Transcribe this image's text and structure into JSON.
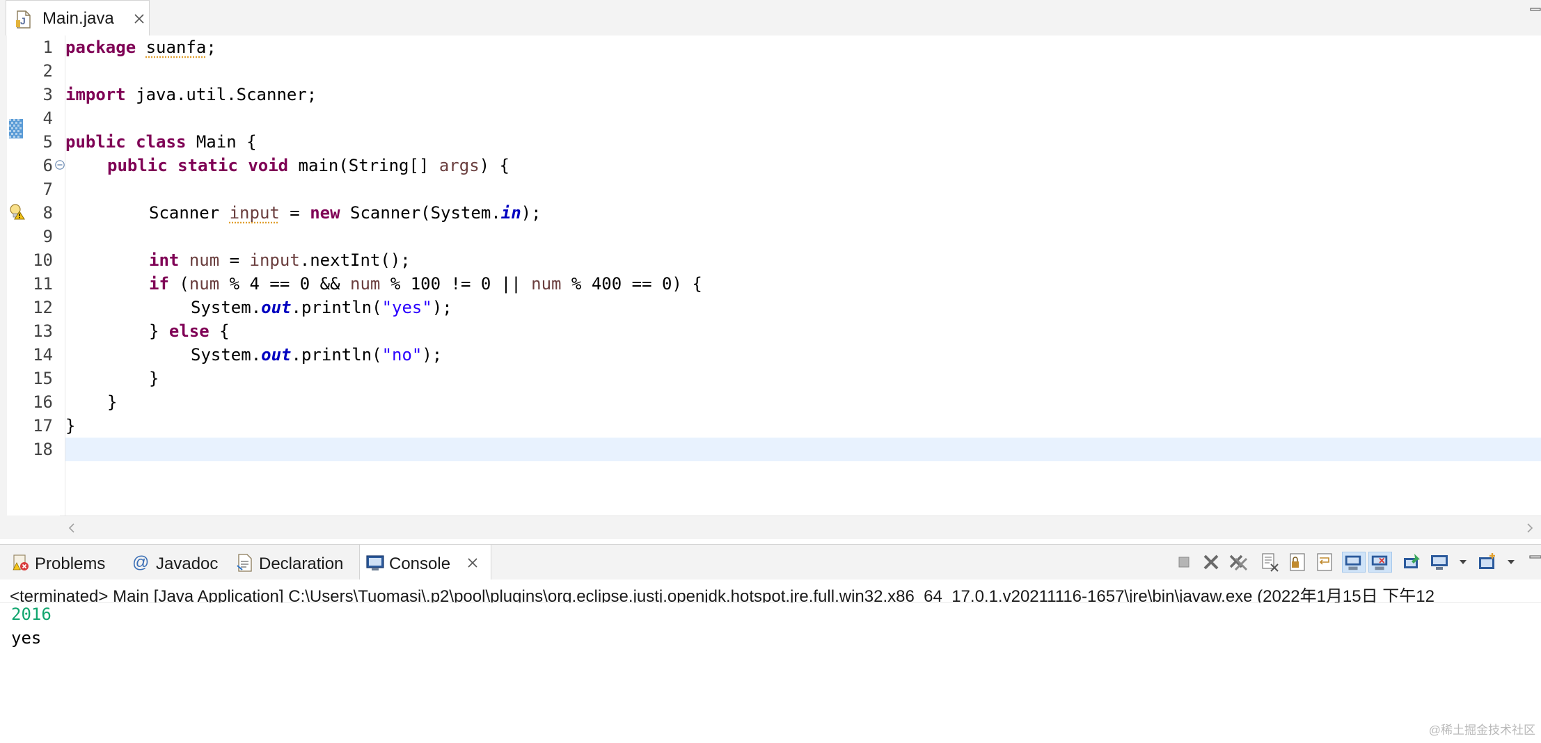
{
  "editor": {
    "tab": {
      "label": "Main.java",
      "icon": "java-file-icon"
    },
    "lines": [
      {
        "n": "1",
        "tokens": [
          {
            "t": "package",
            "c": "kw"
          },
          {
            "t": " "
          },
          {
            "t": "suanfa",
            "c": "warn"
          },
          {
            "t": ";"
          }
        ]
      },
      {
        "n": "2",
        "tokens": []
      },
      {
        "n": "3",
        "tokens": [
          {
            "t": "import",
            "c": "kw"
          },
          {
            "t": " java.util.Scanner;"
          }
        ]
      },
      {
        "n": "4",
        "tokens": []
      },
      {
        "n": "5",
        "tokens": [
          {
            "t": "public",
            "c": "kw"
          },
          {
            "t": " "
          },
          {
            "t": "class",
            "c": "kw"
          },
          {
            "t": " Main {"
          }
        ]
      },
      {
        "n": "6",
        "indent": 1,
        "tokens": [
          {
            "t": "public",
            "c": "kw"
          },
          {
            "t": " "
          },
          {
            "t": "static",
            "c": "kw"
          },
          {
            "t": " "
          },
          {
            "t": "void",
            "c": "kw"
          },
          {
            "t": " main(String[] "
          },
          {
            "t": "args",
            "c": "localvar"
          },
          {
            "t": ") {"
          }
        ]
      },
      {
        "n": "7",
        "tokens": []
      },
      {
        "n": "8",
        "indent": 2,
        "tokens": [
          {
            "t": "Scanner "
          },
          {
            "t": "input",
            "c": "localvar warn"
          },
          {
            "t": " = "
          },
          {
            "t": "new",
            "c": "kw"
          },
          {
            "t": " Scanner(System."
          },
          {
            "t": "in",
            "c": "field"
          },
          {
            "t": ");"
          }
        ]
      },
      {
        "n": "9",
        "tokens": []
      },
      {
        "n": "10",
        "indent": 2,
        "tokens": [
          {
            "t": "int",
            "c": "kw"
          },
          {
            "t": " "
          },
          {
            "t": "num",
            "c": "localvar"
          },
          {
            "t": " = "
          },
          {
            "t": "input",
            "c": "localvar"
          },
          {
            "t": ".nextInt();"
          }
        ]
      },
      {
        "n": "11",
        "indent": 2,
        "tokens": [
          {
            "t": "if",
            "c": "kw"
          },
          {
            "t": " ("
          },
          {
            "t": "num",
            "c": "localvar"
          },
          {
            "t": " % 4 == 0 && "
          },
          {
            "t": "num",
            "c": "localvar"
          },
          {
            "t": " % 100 != 0 || "
          },
          {
            "t": "num",
            "c": "localvar"
          },
          {
            "t": " % 400 == 0) {"
          }
        ]
      },
      {
        "n": "12",
        "indent": 3,
        "tokens": [
          {
            "t": "System."
          },
          {
            "t": "out",
            "c": "field"
          },
          {
            "t": ".println("
          },
          {
            "t": "\"yes\"",
            "c": "str"
          },
          {
            "t": ");"
          }
        ]
      },
      {
        "n": "13",
        "indent": 2,
        "tokens": [
          {
            "t": "} "
          },
          {
            "t": "else",
            "c": "kw"
          },
          {
            "t": " {"
          }
        ]
      },
      {
        "n": "14",
        "indent": 3,
        "tokens": [
          {
            "t": "System."
          },
          {
            "t": "out",
            "c": "field"
          },
          {
            "t": ".println("
          },
          {
            "t": "\"no\"",
            "c": "str"
          },
          {
            "t": ");"
          }
        ]
      },
      {
        "n": "15",
        "indent": 2,
        "tokens": [
          {
            "t": "}"
          }
        ]
      },
      {
        "n": "16",
        "indent": 1,
        "tokens": [
          {
            "t": "}"
          }
        ]
      },
      {
        "n": "17",
        "tokens": [
          {
            "t": "}"
          }
        ]
      },
      {
        "n": "18",
        "current": true,
        "tokens": []
      }
    ]
  },
  "panel": {
    "tabs": [
      {
        "label": "Problems",
        "icon": "problems-icon"
      },
      {
        "label": "Javadoc",
        "icon": "javadoc-icon"
      },
      {
        "label": "Declaration",
        "icon": "declaration-icon"
      },
      {
        "label": "Console",
        "icon": "console-icon",
        "active": true
      }
    ],
    "toolbar_icons": [
      "terminate-icon",
      "remove-launch-icon",
      "remove-all-terminated-icon",
      "clear-console-icon",
      "scroll-lock-icon",
      "word-wrap-icon",
      "show-console-on-stdout-icon",
      "show-console-on-stderr-icon",
      "pin-console-icon",
      "display-selected-console-icon",
      "open-console-icon"
    ]
  },
  "console": {
    "status": "<terminated> Main [Java Application] C:\\Users\\Tuomasi\\.p2\\pool\\plugins\\org.eclipse.justj.openjdk.hotspot.jre.full.win32.x86_64_17.0.1.v20211116-1657\\jre\\bin\\javaw.exe  (2022年1月15日 下午12",
    "input": "2016",
    "output": "yes"
  },
  "watermark": "@稀土掘金技术社区",
  "colors": {
    "keyword": "#7f0055",
    "string": "#2a00ff",
    "field": "#0000c0",
    "local_var": "#6a3e3e",
    "console_input": "#11a56e",
    "current_line": "#e8f2fe"
  }
}
